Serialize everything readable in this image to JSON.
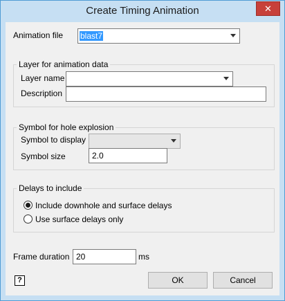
{
  "window": {
    "title": "Create Timing Animation",
    "close_glyph": "✕"
  },
  "animation_file": {
    "label": "Animation file",
    "value": "blast7"
  },
  "layer_group": {
    "title": "Layer for animation data",
    "layer_name_label": "Layer name",
    "layer_name_value": "",
    "description_label": "Description",
    "description_value": ""
  },
  "symbol_group": {
    "title": "Symbol for hole explosion",
    "symbol_label": "Symbol to display",
    "symbol_value": "",
    "size_label": "Symbol size",
    "size_value": "2.0"
  },
  "delays_group": {
    "title": "Delays to include",
    "options": [
      {
        "label": "Include downhole and surface delays",
        "selected": true
      },
      {
        "label": "Use surface delays only",
        "selected": false
      }
    ]
  },
  "frame": {
    "label": "Frame duration",
    "value": "20",
    "unit": "ms"
  },
  "buttons": {
    "ok": "OK",
    "cancel": "Cancel",
    "help_glyph": "?"
  },
  "colors": {
    "titlebar": "#c6dff3",
    "close": "#c7403a",
    "selection": "#3399ff"
  }
}
